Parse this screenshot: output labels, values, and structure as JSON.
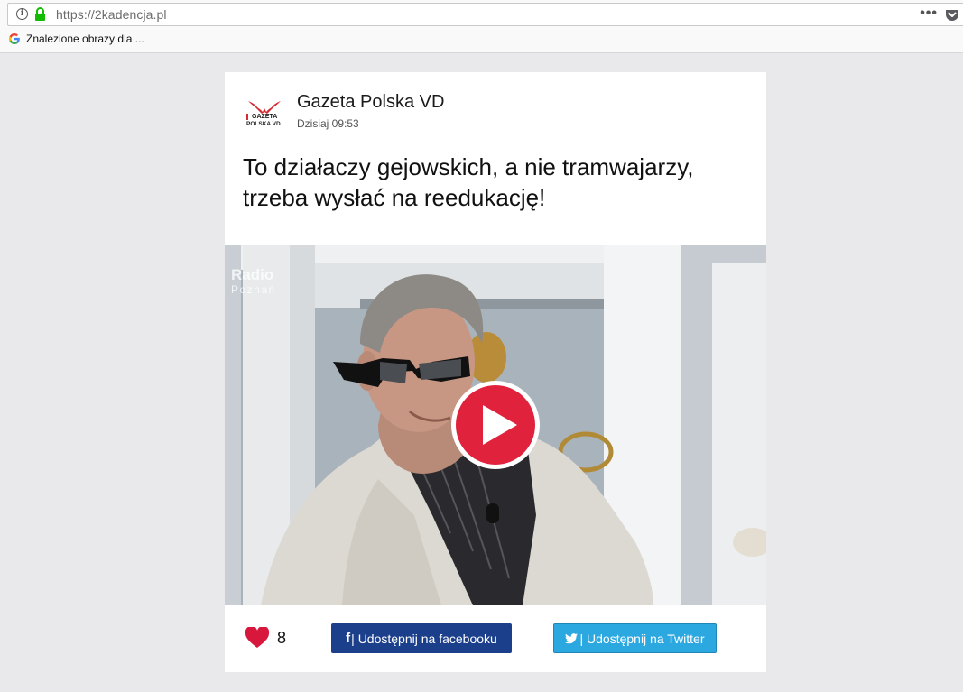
{
  "browser": {
    "url": "https://2kadencja.pl",
    "more_menu": "•••",
    "bookmark_label": "Znalezione obrazy dla ...",
    "info_glyph": "i"
  },
  "post": {
    "author": "Gazeta Polska VD",
    "time": "Dzisiaj 09:53",
    "headline": "To działaczy gejowskich, a nie tramwajarzy, trzeba wysłać na reedukację!",
    "logo_text_1": "GAZETA",
    "logo_text_2": "POLSKA VD"
  },
  "video": {
    "watermark_line1": "Radio",
    "watermark_line2": "Poznań",
    "play_icon": "play-icon",
    "accent_color": "#e1223d"
  },
  "actions": {
    "likes": "8",
    "facebook_label": " | Udostępnij na facebooku",
    "twitter_label": " | Udostępnij na Twitter",
    "facebook_color": "#1c3f8c",
    "twitter_color": "#2ca8e0"
  }
}
